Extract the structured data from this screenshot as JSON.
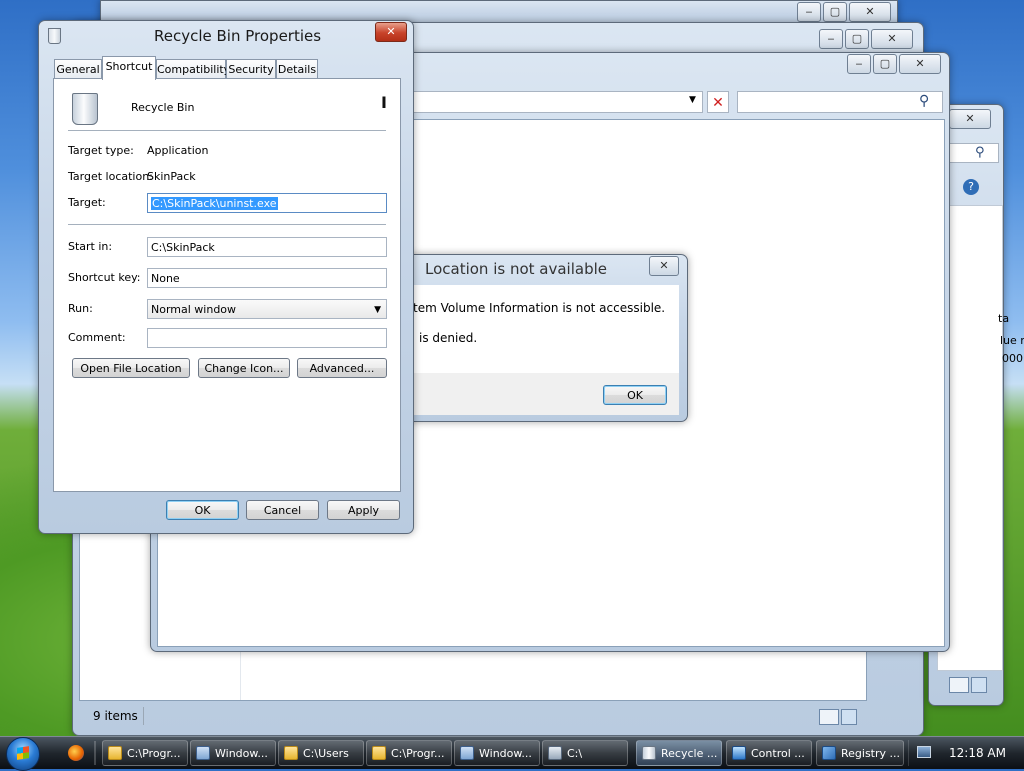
{
  "dialog": {
    "title": "Recycle Bin Properties",
    "tabs": [
      "General",
      "Shortcut",
      "Compatibility",
      "Security",
      "Details"
    ],
    "selected_tab": "Shortcut",
    "item_name": "Recycle Bin",
    "target_type_label": "Target type:",
    "target_type_value": "Application",
    "target_location_label": "Target location:",
    "target_location_value": "SkinPack",
    "target_label": "Target:",
    "target_value": "C:\\SkinPack\\uninst.exe",
    "start_in_label": "Start in:",
    "start_in_value": "C:\\SkinPack",
    "shortcut_key_label": "Shortcut key:",
    "shortcut_key_value": "None",
    "run_label": "Run:",
    "run_value": "Normal window",
    "comment_label": "Comment:",
    "comment_value": "",
    "open_file_location": "Open File Location",
    "change_icon": "Change Icon...",
    "advanced": "Advanced...",
    "ok": "OK",
    "cancel": "Cancel",
    "apply": "Apply"
  },
  "error_dialog": {
    "title": "Location is not available",
    "line1": "tem Volume Information is not accessible.",
    "line2": "is denied.",
    "ok": "OK"
  },
  "explorer": {
    "status": "9 items",
    "right_col_header": "ta",
    "right_col_line1": "lue r",
    "right_col_line2": "000"
  },
  "taskbar": {
    "items": [
      "C:\\Progr...",
      "Window...",
      "C:\\Users",
      "C:\\Progr...",
      "Window...",
      "C:\\",
      "Recycle ...",
      "Control ...",
      "Registry ..."
    ],
    "clock": "12:18 AM"
  }
}
